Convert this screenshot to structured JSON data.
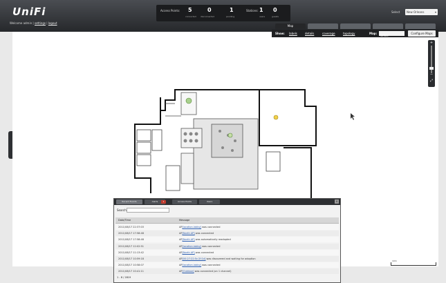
{
  "header": {
    "logo": "UniFi",
    "welcome": "Welcome admin |",
    "settings_link": "settings",
    "logout_link": "logout"
  },
  "stats": {
    "ap_label": "Access Points:",
    "ap_connected": "5",
    "ap_connected_label": "connected",
    "ap_disconnected": "0",
    "ap_disconnected_label": "disconnected",
    "ap_pending": "1",
    "ap_pending_label": "pending",
    "stations_label": "Stations:",
    "stations_users": "1",
    "stations_users_label": "users",
    "stations_guests": "0",
    "stations_guests_label": "guests"
  },
  "site": {
    "label": "Select",
    "value": "New Orleans"
  },
  "tabs": [
    {
      "label": "Map",
      "active": true
    },
    {
      "label": "",
      "active": false
    },
    {
      "label": "",
      "active": false
    },
    {
      "label": "",
      "active": false
    },
    {
      "label": "",
      "active": false
    }
  ],
  "showbar": {
    "show_label": "Show:",
    "items": [
      "labels",
      "details",
      "coverage",
      "topology"
    ],
    "map_label": "Map:",
    "map_value": "Office",
    "configure_button": "Configure Maps"
  },
  "map": {
    "scale_label": "10m",
    "zoom_plus": "+",
    "zoom_minus": "−",
    "zoom_level": 0.15
  },
  "log": {
    "tabs": [
      {
        "label": "Recent Events",
        "active": true
      },
      {
        "label": "Alerts",
        "active": false
      },
      {
        "label": "Access Points",
        "active": false
      },
      {
        "label": "Users",
        "active": false
      }
    ],
    "alerts_badge": "1",
    "close": "x",
    "search_label": "Search",
    "search_value": "",
    "columns": [
      "Date/Time",
      "Message"
    ],
    "rows": [
      {
        "time": "2011/08/17 22:37:03",
        "prefix": "AP",
        "link": "[location-lobby]",
        "text": " was connected"
      },
      {
        "time": "2011/08/17 17:58:48",
        "prefix": "AP",
        "link": "[North AP]",
        "text": " was connected"
      },
      {
        "time": "2011/08/17 17:58:48",
        "prefix": "AP",
        "link": "[North AP]",
        "text": " was automatically readopted"
      },
      {
        "time": "2011/08/17 12:02:51",
        "prefix": "AP",
        "link": "[location-lobby]",
        "text": " was connected"
      },
      {
        "time": "2011/08/17 11:13:42",
        "prefix": "AP",
        "link": "[North AP]",
        "text": " was connected"
      },
      {
        "time": "2011/08/17 10:59:18",
        "prefix": "AP",
        "link": "[00:27:22:5c:2f:1d]",
        "text": " was discovered and waiting for adoption"
      },
      {
        "time": "2011/08/17 10:58:07",
        "prefix": "AP",
        "link": "[location-lobby]",
        "text": " was connected"
      },
      {
        "time": "2011/08/17 10:41:11",
        "prefix": "AP",
        "link": "[Outdoor]",
        "text": " was connected (on 1 channel)"
      }
    ],
    "pager": "1 - 8 / 2819"
  },
  "colors": {
    "topbar": "#2f3134",
    "accent_badge": "#c0392b",
    "link": "#2a5db0",
    "floor_fill": "#e4e4e4"
  }
}
